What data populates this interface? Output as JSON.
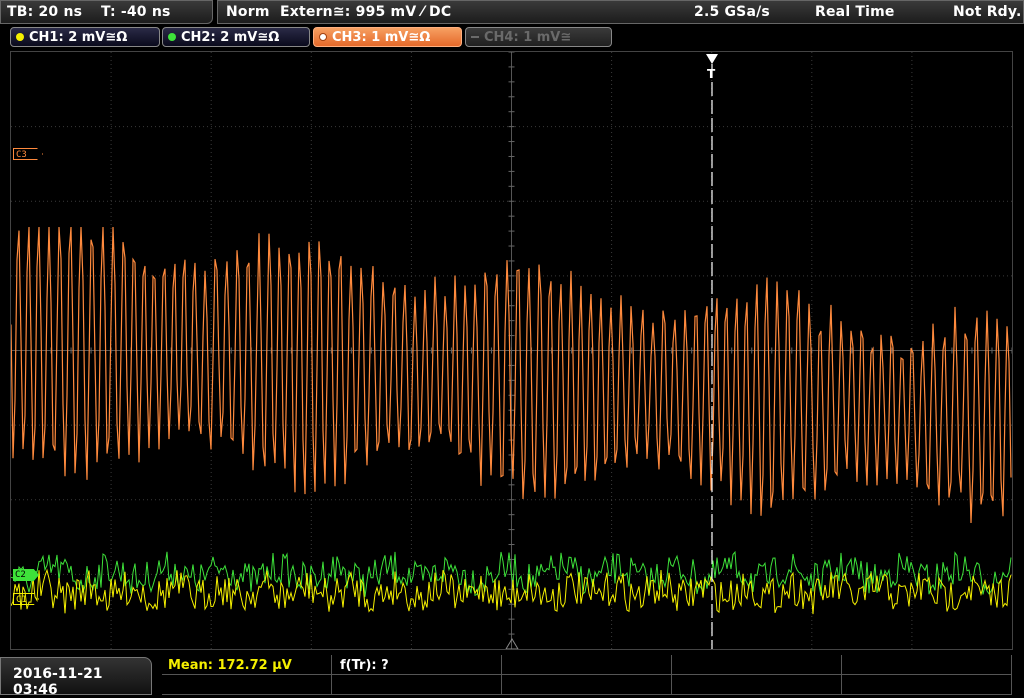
{
  "header": {
    "timebase": "TB: 20 ns",
    "trigger_offset": "T: -40 ns",
    "trigger_mode": "Norm",
    "trigger_source": "Extern≅: 995 mV ⁄ DC",
    "sample_rate": "2.5 GSa/s",
    "acquisition": "Real Time",
    "status": "Not Rdy."
  },
  "channels": [
    {
      "label": "CH1: 2 mV≅Ω",
      "color": "#f5f000",
      "active": true
    },
    {
      "label": "CH2: 2 mV≅Ω",
      "color": "#3ee23a",
      "active": true
    },
    {
      "label": "CH3: 1 mV≅Ω",
      "color": "#ff8a3d",
      "active": true,
      "selected": true
    },
    {
      "label": "CH4: 1 mV≅",
      "color": "#777777",
      "active": false
    }
  ],
  "markers": {
    "ch3": "C3",
    "ch2": "C2",
    "ch1": "C1",
    "trigger_position": "T"
  },
  "footer": {
    "datetime": "2016-11-21 03:46",
    "measurement_1": "Mean: 172.72 µV",
    "measurement_2": "f(Tr): ?"
  },
  "colors": {
    "ch1": "#f5f000",
    "ch2": "#3ee23a",
    "ch3": "#ff8a3d",
    "grid": "#3a3a3a",
    "background": "#000000"
  }
}
